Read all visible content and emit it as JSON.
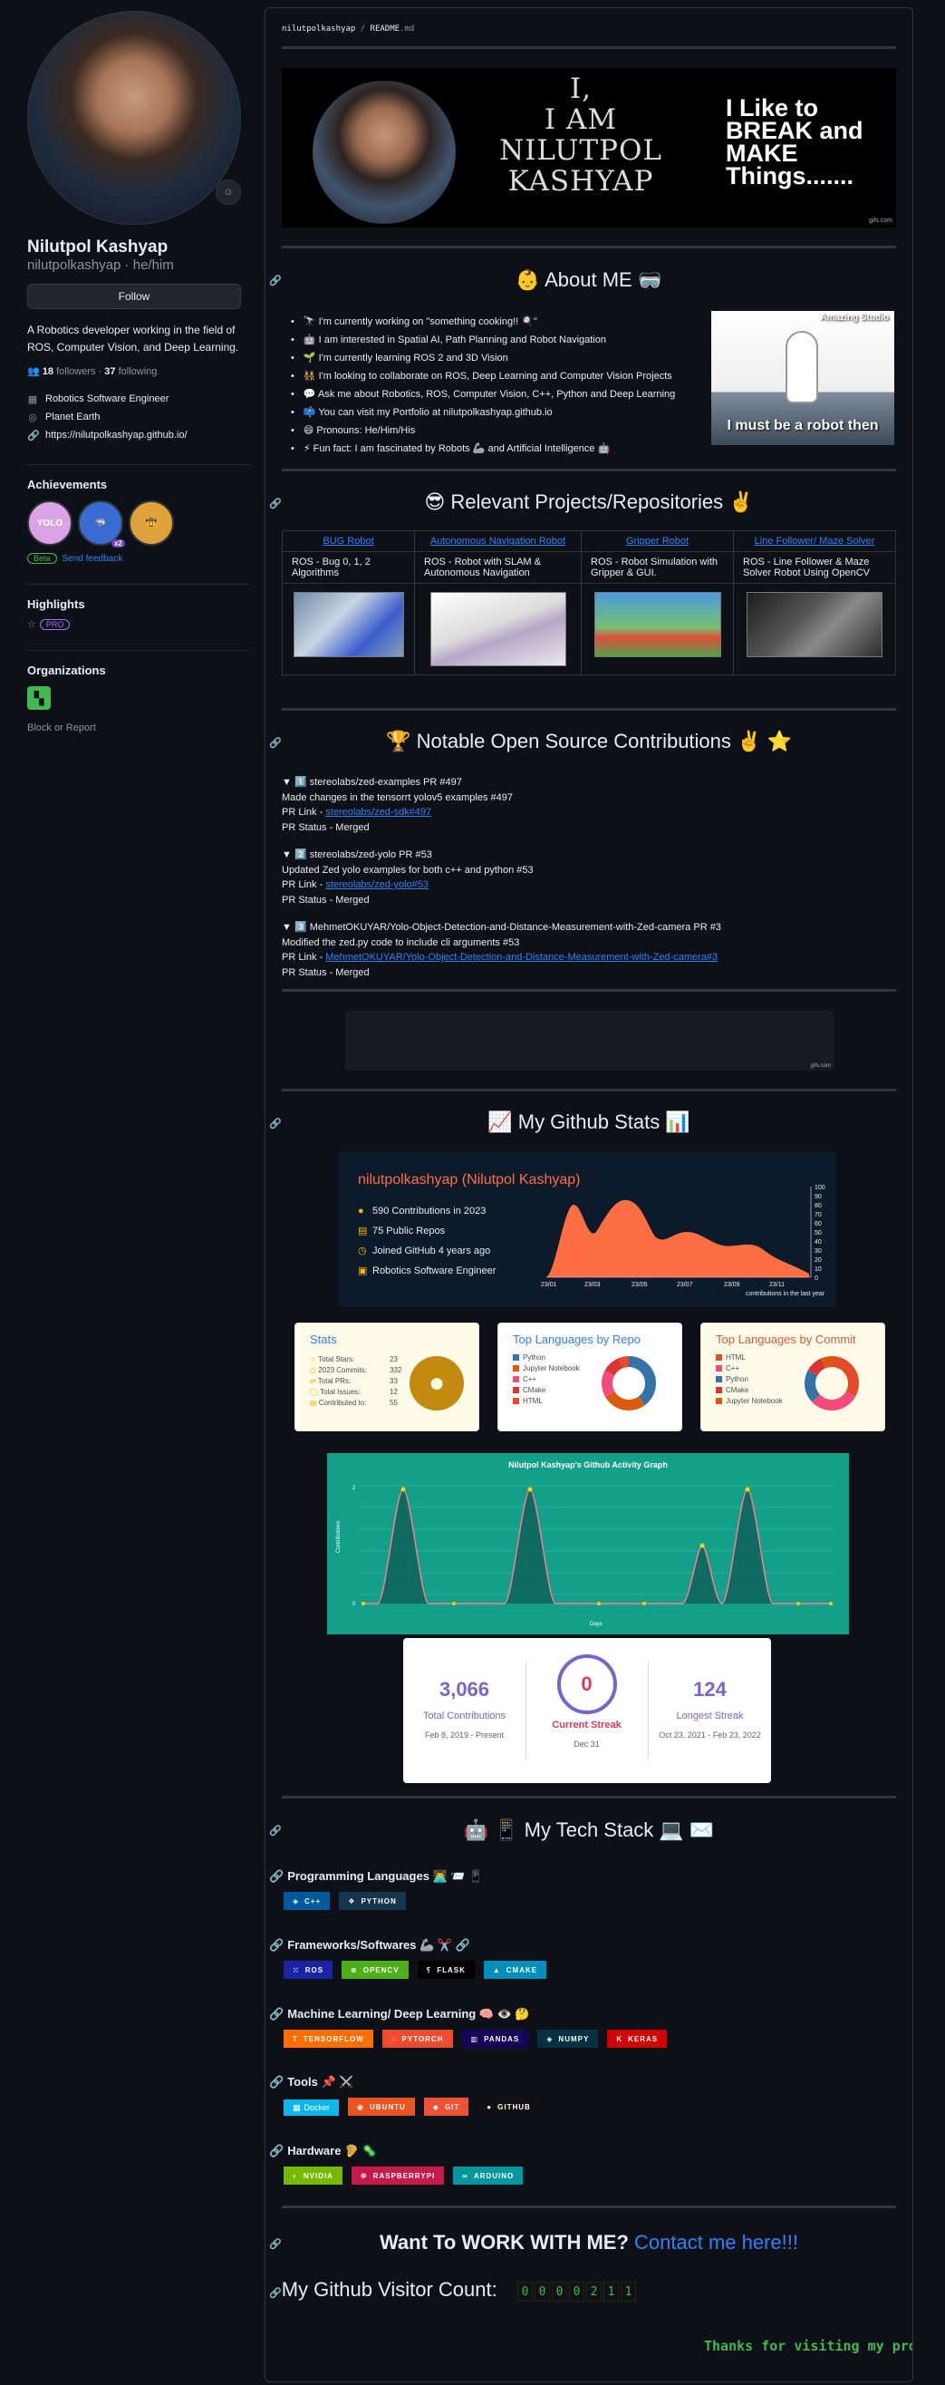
{
  "profile": {
    "name": "Nilutpol Kashyap",
    "login": "nilutpolkashyap · he/him",
    "follow": "Follow",
    "bio": "A Robotics developer working in the field of ROS, Computer Vision, and Deep Learning.",
    "followers_count": "18",
    "followers_label": "followers",
    "following_count": "37",
    "following_label": "following",
    "job": "Robotics Software Engineer",
    "location": "Planet Earth",
    "website": "https://nilutpolkashyap.github.io/",
    "achievements_title": "Achievements",
    "beta": "Beta",
    "send_feedback": "Send feedback",
    "highlights_title": "Highlights",
    "pro": "PRO",
    "organizations_title": "Organizations",
    "block": "Block or Report",
    "badge_yolo": "YOLO",
    "badge_x2": "x2"
  },
  "readme": {
    "path_user": "nilutpolkashyap",
    "path_sep": " / ",
    "path_file": "README",
    "path_ext": ".md",
    "banner_line1": "I,",
    "banner_line2": "I AM",
    "banner_line3": "NILUTPOL",
    "banner_line4": "KASHYAP",
    "banner_right": "I Like to BREAK and MAKE Things.......",
    "banner_credit": "gifs.com",
    "about_title": "👶 About ME 🥽",
    "about": [
      "🔭 I'm currently working on \"something cooking!! 🍳\"",
      "🤖 I am interested in Spatial AI, Path Planning and Robot Navigation",
      "🌱 I'm currently learning ROS 2 and 3D Vision",
      "👯 I'm looking to collaborate on ROS, Deep Learning and Computer Vision Projects",
      "💬 Ask me about Robotics, ROS, Computer Vision, C++, Python and Deep Learning",
      "📫 You can visit my Portfolio at nilutpolkashyap.github.io",
      "😄 Pronouns: He/Him/His",
      "⚡ Fun fact: I am fascinated by Robots 🦾 and Artificial Intelligence 🤖"
    ],
    "robot_gif_top": "Amazing Studio",
    "robot_gif_caption": "I must be a robot then",
    "projects_title": "😎 Relevant Projects/Repositories ✌️",
    "projects": [
      {
        "name": "BUG Robot",
        "desc": "ROS - Bug 0, 1, 2 Algorithms"
      },
      {
        "name": "Autonomous Navigation Robot",
        "desc": "ROS - Robot with SLAM & Autonomous Navigation"
      },
      {
        "name": "Gripper Robot",
        "desc": "ROS - Robot Simulation with Gripper & GUI."
      },
      {
        "name": "Line Follower/ Maze Solver",
        "desc": "ROS - Line Follower & Maze Solver Robot Using OpenCV"
      }
    ],
    "contrib_title": "🏆 Notable Open Source Contributions ✌️ ⭐",
    "contribs": [
      {
        "head": "▼ 1️⃣ stereolabs/zed-examples PR #497",
        "desc": "Made changes in the tensorrt yolov5 examples #497",
        "link_label": "PR Link - ",
        "link": "stereolabs/zed-sdk#497",
        "status": "PR Status - Merged"
      },
      {
        "head": "▼ 2️⃣ stereolabs/zed-yolo PR #53",
        "desc": "Updated Zed yolo examples for both c++ and python #53",
        "link_label": "PR Link - ",
        "link": "stereolabs/zed-yolo#53",
        "status": "PR Status - Merged"
      },
      {
        "head": "▼ 3️⃣ MehmetOKUYAR/Yolo-Object-Detection-and-Distance-Measurement-with-Zed-camera PR #3",
        "desc": "Modified the zed.py code to include cli arguments #53",
        "link_label": "PR Link - ",
        "link": "MehmetOKUYAR/Yolo-Object-Detection-and-Distance-Measurement-with-Zed-camera#3",
        "status": "PR Status - Merged"
      }
    ],
    "empty_credit": "gifs.com",
    "stats_title": "📈 My Github Stats 📊",
    "stats1": {
      "name": "nilutpolkashyap (Nilutpol Kashyap)",
      "contributions": "590 Contributions in 2023",
      "repos": "75 Public Repos",
      "joined": "Joined GitHub 4 years ago",
      "job": "Robotics Software Engineer",
      "chart_caption": "contributions in the last year"
    },
    "stats_card": {
      "title": "Stats",
      "rows": [
        {
          "k": "Total Stars:",
          "v": "23"
        },
        {
          "k": "2023 Commits:",
          "v": "332"
        },
        {
          "k": "Total PRs:",
          "v": "33"
        },
        {
          "k": "Total Issues:",
          "v": "12"
        },
        {
          "k": "Contributed to:",
          "v": "55"
        }
      ]
    },
    "lang_repo": {
      "title": "Top Languages by Repo",
      "items": [
        "Python",
        "Jupyter Notebook",
        "C++",
        "CMake",
        "HTML"
      ]
    },
    "lang_commit": {
      "title": "Top Languages by Commit",
      "items": [
        "HTML",
        "C++",
        "Python",
        "CMake",
        "Jupyter Notebook"
      ]
    },
    "activity": {
      "title": "Nilutpol Kashyap's Github Activity Graph",
      "ylabel": "Contributions",
      "xlabel": "Days"
    },
    "streak": {
      "total": "3,066",
      "total_label": "Total Contributions",
      "total_range": "Feb 8, 2019 - Present",
      "current": "0",
      "current_label": "Current Streak",
      "current_date": "Dec 31",
      "longest": "124",
      "longest_label": "Longest Streak",
      "longest_range": "Oct 23, 2021 - Feb 23, 2022"
    },
    "tech_title": "🤖 📱 My Tech Stack 💻 ✉️",
    "tech": [
      {
        "heading": "Programming Languages 👨‍💻 📨 📱",
        "badges": [
          {
            "label": "C++",
            "color": "#00599C"
          },
          {
            "label": "PYTHON",
            "color": "#14354C"
          }
        ]
      },
      {
        "heading": "Frameworks/Softwares 🦾 ✂️ 🔗",
        "badges": [
          {
            "label": "ROS",
            "color": "#22314E"
          },
          {
            "label": "OPENCV",
            "color": "#27338e"
          },
          {
            "label": "FLASK",
            "color": "#000000"
          },
          {
            "label": "CMAKE",
            "color": "#008FBA"
          }
        ]
      },
      {
        "heading": "Machine Learning/ Deep Learning 🧠 👁️ 🤔",
        "badges": [
          {
            "label": "TENSORFLOW",
            "color": "#FF6F00"
          },
          {
            "label": "PYTORCH",
            "color": "#EE4C2C"
          },
          {
            "label": "PANDAS",
            "color": "#150458"
          },
          {
            "label": "NUMPY",
            "color": "#013243"
          },
          {
            "label": "KERAS",
            "color": "#D00000"
          }
        ]
      },
      {
        "heading": "Tools 📌 ⚔️",
        "badges": [
          {
            "label": "Docker",
            "color": "#0db7ed"
          },
          {
            "label": "UBUNTU",
            "color": "#E95420"
          },
          {
            "label": "GIT",
            "color": "#F05033"
          },
          {
            "label": "GITHUB",
            "color": "#121011"
          }
        ]
      },
      {
        "heading": "Hardware 🦻 🦠",
        "badges": [
          {
            "label": "NVIDIA",
            "color": "#76B900"
          },
          {
            "label": "RASPBERRYPI",
            "color": "#C51A4A"
          },
          {
            "label": "ARDUINO",
            "color": "#00979D"
          }
        ]
      }
    ],
    "work_text": "Want To WORK WITH ME?",
    "work_link": "Contact me here!!!",
    "visitor_label": "My Github Visitor Count:",
    "visitor_digits": [
      "0",
      "0",
      "0",
      "0",
      "2",
      "1",
      "1"
    ],
    "thanks": "Thanks for visiting my profile"
  }
}
